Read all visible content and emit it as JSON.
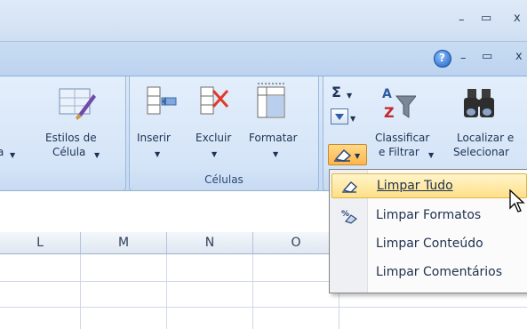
{
  "window": {
    "minimize": "–",
    "restore": "▭",
    "close": "x"
  },
  "ribbonbar": {
    "help": "?",
    "minimize": "–",
    "restore": "▭",
    "close": "x"
  },
  "ribbon": {
    "estilos": {
      "label1": "Estilos de",
      "label2": "Célula",
      "prev_tail": "a"
    },
    "celulas": {
      "group_label": "Células",
      "inserir": "Inserir",
      "excluir": "Excluir",
      "formatar": "Formatar"
    },
    "edicao": {
      "sigma": "Σ",
      "classificar1": "Classificar",
      "classificar2": "e Filtrar",
      "localizar1": "Localizar e",
      "localizar2": "Selecionar"
    }
  },
  "columns": [
    "L",
    "M",
    "N",
    "O"
  ],
  "menu": {
    "items": [
      {
        "label": "Limpar Tudo",
        "highlighted": true,
        "icon": "eraser-icon"
      },
      {
        "label": "Limpar Formatos",
        "highlighted": false,
        "icon": "clear-formats-icon"
      },
      {
        "label": "Limpar Conteúdo",
        "highlighted": false,
        "icon": ""
      },
      {
        "label": "Limpar Comentários",
        "highlighted": false,
        "icon": ""
      }
    ]
  },
  "colors": {
    "accent": "#ffe08a",
    "ribbon": "#d4e4f7",
    "text": "#1e3354"
  }
}
